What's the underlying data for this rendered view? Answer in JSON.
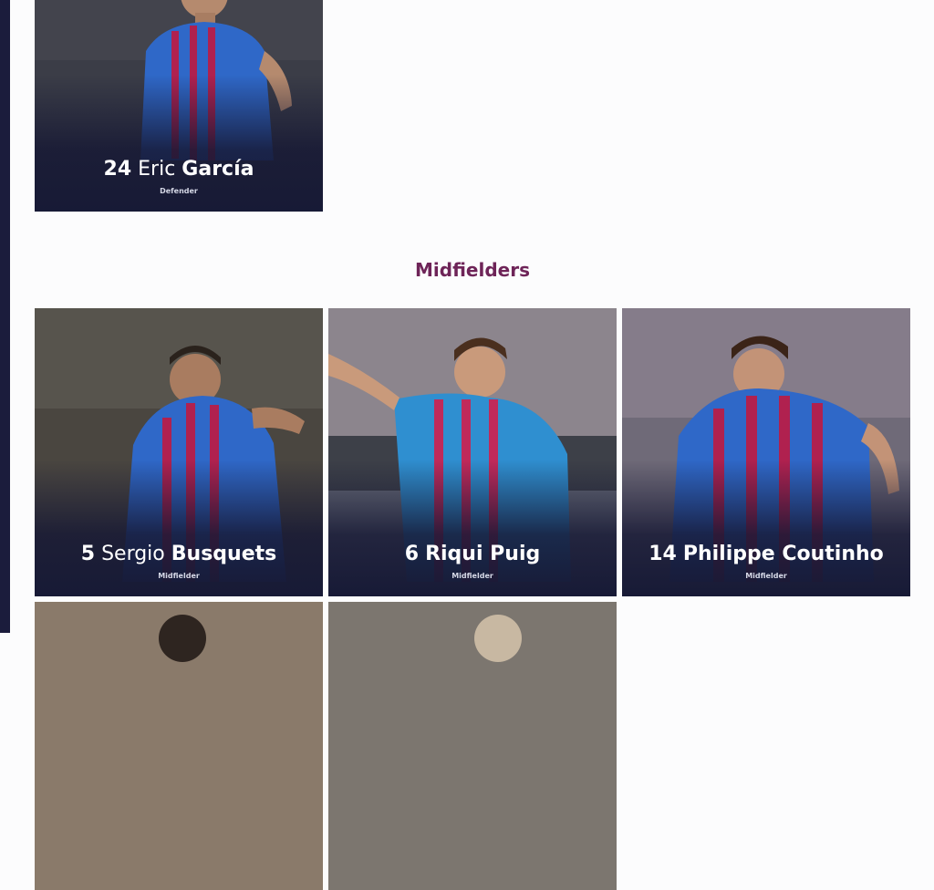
{
  "defenders": {
    "cards": [
      {
        "number": "24",
        "first": "Eric",
        "last": "García",
        "role": "Defender"
      }
    ]
  },
  "midfielders": {
    "title": "Midfielders",
    "cards": [
      {
        "number": "5",
        "first": "Sergio",
        "last": "Busquets",
        "role": "Midfielder"
      },
      {
        "number": "6",
        "first": "",
        "last": "Riqui Puig",
        "role": "Midfielder"
      },
      {
        "number": "14",
        "first": "",
        "last": "Philippe Coutinho",
        "role": "Midfielder"
      }
    ]
  },
  "colors": {
    "section_title": "#6e2458",
    "card_overlay": "#171a36",
    "kit_blue": "#2f68c8",
    "kit_garnet": "#b0214f"
  }
}
